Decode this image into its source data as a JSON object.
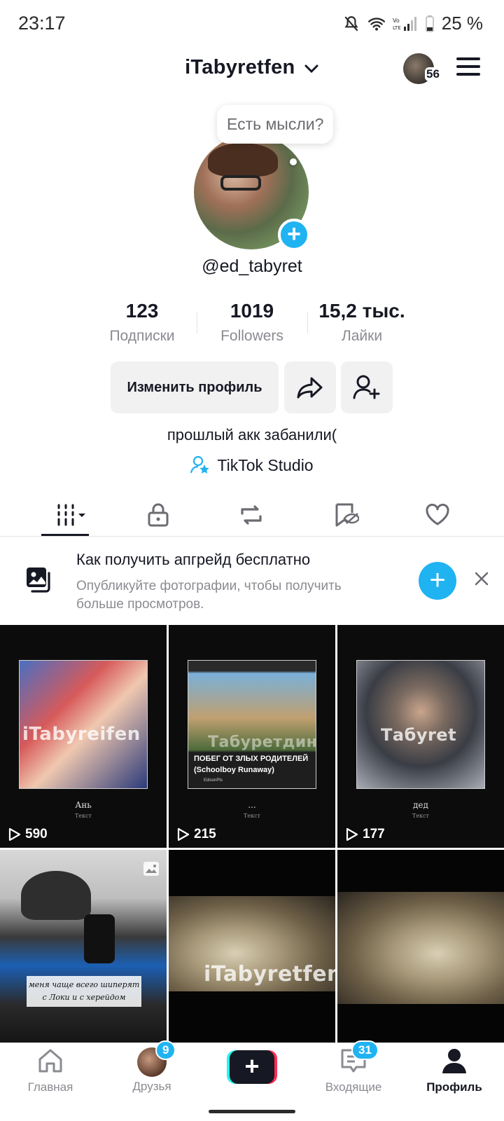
{
  "status_bar": {
    "time": "23:17",
    "battery": "25 %"
  },
  "header": {
    "username": "iTabyretfen",
    "story_count": "56"
  },
  "profile": {
    "thought_bubble": "Есть мысли?",
    "handle": "@ed_tabyret",
    "stats": [
      {
        "value": "123",
        "label": "Подписки"
      },
      {
        "value": "1019",
        "label": "Followers"
      },
      {
        "value": "15,2 тыс.",
        "label": "Лайки"
      }
    ],
    "edit_button": "Изменить профиль",
    "bio": "прошлый акк забанили(",
    "studio_link": "TikTok Studio"
  },
  "banner": {
    "title": "Как получить апгрейд бесплатно",
    "subtitle": "Опубликуйте фотографии, чтобы получить больше просмотров."
  },
  "videos": [
    {
      "views": "590",
      "caption": "Ань",
      "subcaption": "Текст",
      "watermark": "iTabyreifen"
    },
    {
      "views": "215",
      "caption": "...",
      "subcaption": "Текст",
      "watermark": "Табуретдин",
      "overlay_title": "ПОБЕГ ОТ ЗЛЫХ РОДИТЕЛЕЙ",
      "overlay_sub": "(Schoolboy Runaway)",
      "overlay_author": "EdisonPts"
    },
    {
      "views": "177",
      "caption": "дед",
      "subcaption": "Текст",
      "watermark": "Табyret"
    },
    {
      "caption_line1": "меня чаще всего шиперят",
      "caption_line2": "с Локи и с херейдом"
    },
    {
      "watermark": "iTabyretfen"
    },
    {
      "watermark": ""
    }
  ],
  "nav": {
    "home": "Главная",
    "friends": "Друзья",
    "friends_badge": "9",
    "inbox": "Входящие",
    "inbox_badge": "31",
    "profile": "Профиль"
  },
  "colors": {
    "accent": "#20b3f2",
    "text": "#161823",
    "muted": "#8a8b91"
  }
}
